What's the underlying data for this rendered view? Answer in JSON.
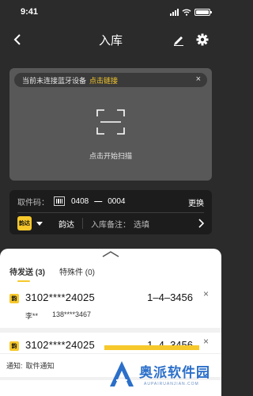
{
  "status_bar": {
    "time": "9:41"
  },
  "nav": {
    "title": "入库"
  },
  "scan": {
    "bt_text": "当前未连接蓝牙设备",
    "bt_link": "点击链接",
    "bt_close": "×",
    "label": "点击开始扫描"
  },
  "pickup": {
    "label": "取件码：",
    "code_a": "0408",
    "dash": "—",
    "code_b": "0004",
    "change": "更换"
  },
  "courier": {
    "logo_text": "韵达",
    "name": "韵达",
    "note_label": "入库备注：",
    "note_value": "选填"
  },
  "tabs": [
    {
      "label": "待发送 (3)",
      "active": true
    },
    {
      "label": "特殊件 (0)",
      "active": false
    }
  ],
  "items": [
    {
      "badge": "韵",
      "code": "3102****24025",
      "shelf": "1–4–3456",
      "close": "×",
      "name": "李**",
      "phone": "138****3467"
    },
    {
      "badge": "韵",
      "code": "3102****24025",
      "shelf": "1–4–3456",
      "close": "×",
      "name": "",
      "phone": ""
    }
  ],
  "notice": {
    "label": "通知:",
    "value": "取件通知"
  },
  "watermark": {
    "text": "奥派软件园",
    "sub": "AUPAIRUANJIAN.COM"
  },
  "colors": {
    "accent": "#f6c82b",
    "dark_bg": "#2b2b2b",
    "card_bg": "#585858",
    "info_bg": "#1c1c1c",
    "watermark": "#2b6fc9"
  }
}
